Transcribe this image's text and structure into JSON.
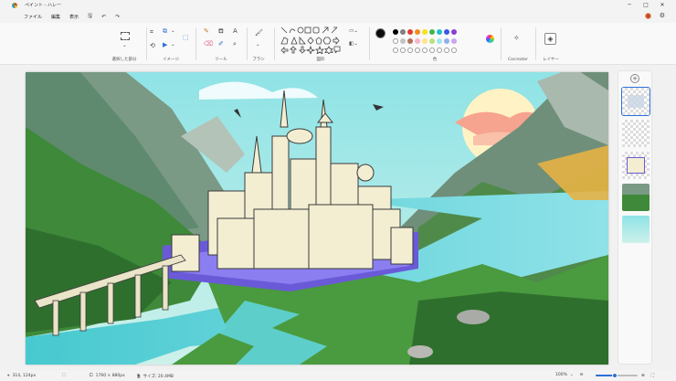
{
  "window": {
    "title": "ペイント - ハレー",
    "controls": [
      "─",
      "□",
      "✕"
    ]
  },
  "menu": {
    "items": [
      "ファイル",
      "編集",
      "表示"
    ],
    "icons": [
      "save-icon",
      "undo-icon",
      "redo-icon"
    ]
  },
  "ribbon": {
    "groups": [
      {
        "label": "選択した部分"
      },
      {
        "label": "イメージ"
      },
      {
        "label": "ツール"
      },
      {
        "label": "ブラシ"
      },
      {
        "label": "図形"
      },
      {
        "label": "色"
      },
      {
        "label": "Cocreator"
      },
      {
        "label": "レイヤー"
      }
    ],
    "current_color": "#0b0b0b",
    "palette_row1": [
      "#000000",
      "#7f7f7f",
      "#e03c31",
      "#f08c1e",
      "#f7e01e",
      "#44b44a",
      "#1ec0d0",
      "#3a58e8",
      "#8a3fd0"
    ],
    "palette_row2": [
      "#ffffff",
      "#c3c3c3",
      "#b0735a",
      "#f7b4c8",
      "#ffe38a",
      "#b7e37a",
      "#9ee6f0",
      "#8fb0f0",
      "#c8a6f0"
    ]
  },
  "layers": {
    "count": 5
  },
  "status": {
    "cursor": "314, 124px",
    "canvas_size": "1760 × 880px",
    "file_size": "サイズ: 20.4MB",
    "zoom": "100%",
    "zoom_level": 0.45
  }
}
